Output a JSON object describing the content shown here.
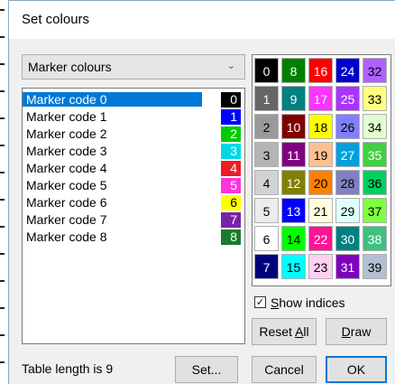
{
  "dialog": {
    "title": "Set colours"
  },
  "combo": {
    "value": "Marker colours",
    "chevron": "⌄"
  },
  "list": [
    {
      "label": "Marker code 0",
      "code": "0",
      "bg": "#000000",
      "fg": "#ffffff",
      "selected": true
    },
    {
      "label": "Marker code 1",
      "code": "1",
      "bg": "#0000ff",
      "fg": "#ffffff"
    },
    {
      "label": "Marker code 2",
      "code": "2",
      "bg": "#00cc00",
      "fg": "#ffffff"
    },
    {
      "label": "Marker code 3",
      "code": "3",
      "bg": "#00d8e8",
      "fg": "#ffffff"
    },
    {
      "label": "Marker code 4",
      "code": "4",
      "bg": "#ee1c24",
      "fg": "#ffffff"
    },
    {
      "label": "Marker code 5",
      "code": "5",
      "bg": "#ff33dd",
      "fg": "#ffffff"
    },
    {
      "label": "Marker code 6",
      "code": "6",
      "bg": "#ffff00",
      "fg": "#000000"
    },
    {
      "label": "Marker code 7",
      "code": "7",
      "bg": "#7a22aa",
      "fg": "#ffffff"
    },
    {
      "label": "Marker code 8",
      "code": "8",
      "bg": "#1b7a2a",
      "fg": "#ffffff"
    }
  ],
  "palette": [
    {
      "n": "0",
      "bg": "#000000",
      "fg": "#ffffff",
      "sel": true
    },
    {
      "n": "1",
      "bg": "#666666",
      "fg": "#ffffff"
    },
    {
      "n": "2",
      "bg": "#999999",
      "fg": "#000000"
    },
    {
      "n": "3",
      "bg": "#b4b4b4",
      "fg": "#000000"
    },
    {
      "n": "4",
      "bg": "#d2d2d2",
      "fg": "#000000"
    },
    {
      "n": "5",
      "bg": "#ececec",
      "fg": "#000000"
    },
    {
      "n": "6",
      "bg": "#ffffff",
      "fg": "#000000"
    },
    {
      "n": "7",
      "bg": "#00007a",
      "fg": "#ffffff"
    },
    {
      "n": "8",
      "bg": "#008000",
      "fg": "#ffffff"
    },
    {
      "n": "9",
      "bg": "#008080",
      "fg": "#ffffff"
    },
    {
      "n": "10",
      "bg": "#800000",
      "fg": "#ffffff"
    },
    {
      "n": "11",
      "bg": "#800080",
      "fg": "#ffffff"
    },
    {
      "n": "12",
      "bg": "#808000",
      "fg": "#ffffff"
    },
    {
      "n": "13",
      "bg": "#0000ff",
      "fg": "#ffffff"
    },
    {
      "n": "14",
      "bg": "#00ff00",
      "fg": "#000000"
    },
    {
      "n": "15",
      "bg": "#00ffff",
      "fg": "#000000"
    },
    {
      "n": "16",
      "bg": "#ff0000",
      "fg": "#ffffff"
    },
    {
      "n": "17",
      "bg": "#ff33ff",
      "fg": "#ffffff"
    },
    {
      "n": "18",
      "bg": "#ffff00",
      "fg": "#000000"
    },
    {
      "n": "19",
      "bg": "#ffc090",
      "fg": "#000000"
    },
    {
      "n": "20",
      "bg": "#ff8000",
      "fg": "#000000"
    },
    {
      "n": "21",
      "bg": "#ffffe0",
      "fg": "#000000"
    },
    {
      "n": "22",
      "bg": "#ff1493",
      "fg": "#ffffff"
    },
    {
      "n": "23",
      "bg": "#ffd0f0",
      "fg": "#000000"
    },
    {
      "n": "24",
      "bg": "#0000cc",
      "fg": "#ffffff"
    },
    {
      "n": "25",
      "bg": "#aa33ff",
      "fg": "#ffffff"
    },
    {
      "n": "26",
      "bg": "#8080ff",
      "fg": "#000000"
    },
    {
      "n": "27",
      "bg": "#00a0e0",
      "fg": "#ffffff"
    },
    {
      "n": "28",
      "bg": "#8080c0",
      "fg": "#000000"
    },
    {
      "n": "29",
      "bg": "#e0ffff",
      "fg": "#000000"
    },
    {
      "n": "30",
      "bg": "#008080",
      "fg": "#ffffff"
    },
    {
      "n": "31",
      "bg": "#8000c0",
      "fg": "#ffffff"
    },
    {
      "n": "32",
      "bg": "#b060ff",
      "fg": "#000000"
    },
    {
      "n": "33",
      "bg": "#ffff80",
      "fg": "#000000"
    },
    {
      "n": "34",
      "bg": "#e0ffd0",
      "fg": "#000000"
    },
    {
      "n": "35",
      "bg": "#40d040",
      "fg": "#ffffff"
    },
    {
      "n": "36",
      "bg": "#00d060",
      "fg": "#000000"
    },
    {
      "n": "37",
      "bg": "#80ff40",
      "fg": "#000000"
    },
    {
      "n": "38",
      "bg": "#40c080",
      "fg": "#ffffff"
    },
    {
      "n": "39",
      "bg": "#b0c0d0",
      "fg": "#000000"
    }
  ],
  "checkbox": {
    "prefix": "",
    "accel": "S",
    "rest": "how indices",
    "checked": "✓"
  },
  "buttons": {
    "reset_pre": "Reset ",
    "reset_accel": "A",
    "reset_post": "ll",
    "draw_accel": "D",
    "draw_post": "raw",
    "set": "Set...",
    "cancel": "Cancel",
    "ok": "OK"
  },
  "footer": {
    "table_length": "Table length is 9"
  }
}
